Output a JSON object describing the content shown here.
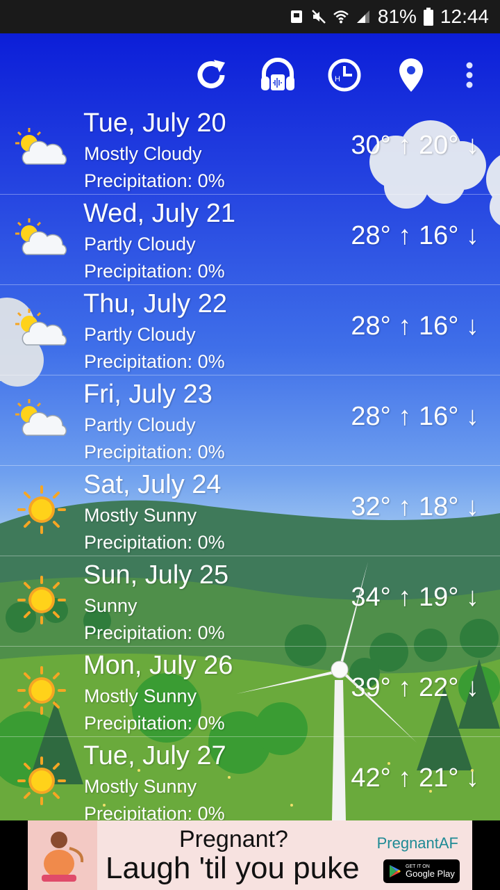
{
  "status_bar": {
    "battery": "81%",
    "time": "12:44"
  },
  "toolbar": {
    "refresh_icon": "refresh-icon",
    "sounds_icon": "headphones-icon",
    "hourly_icon": "hourly-clock-icon",
    "location_icon": "location-pin-icon",
    "menu_icon": "more-vert-icon"
  },
  "forecast": [
    {
      "date": "Tue, July 20",
      "condition": "Mostly Cloudy",
      "precipitation": "Precipitation:  0%",
      "temps": "30° ↑ 20° ↓",
      "icon": "sun-cloud"
    },
    {
      "date": "Wed, July 21",
      "condition": "Partly Cloudy",
      "precipitation": "Precipitation:  0%",
      "temps": "28° ↑ 16° ↓",
      "icon": "sun-cloud"
    },
    {
      "date": "Thu, July 22",
      "condition": "Partly Cloudy",
      "precipitation": "Precipitation:  0%",
      "temps": "28° ↑ 16° ↓",
      "icon": "sun-cloud"
    },
    {
      "date": "Fri, July 23",
      "condition": "Partly Cloudy",
      "precipitation": "Precipitation:  0%",
      "temps": "28° ↑ 16° ↓",
      "icon": "sun-cloud"
    },
    {
      "date": "Sat, July 24",
      "condition": "Mostly Sunny",
      "precipitation": "Precipitation:  0%",
      "temps": "32° ↑ 18° ↓",
      "icon": "sun"
    },
    {
      "date": "Sun, July 25",
      "condition": "Sunny",
      "precipitation": "Precipitation:  0%",
      "temps": "34° ↑ 19° ↓",
      "icon": "sun"
    },
    {
      "date": "Mon, July 26",
      "condition": "Mostly Sunny",
      "precipitation": "Precipitation:  0%",
      "temps": "39° ↑ 22° ↓",
      "icon": "sun"
    },
    {
      "date": "Tue, July 27",
      "condition": "Mostly Sunny",
      "precipitation": "Precipitation:  0%",
      "temps": "42° ↑ 21° ↓",
      "icon": "sun"
    }
  ],
  "ad": {
    "headline": "Pregnant?",
    "body": "Laugh 'til you puke",
    "brand": "PregnantAF",
    "store_small": "GET IT ON",
    "store_big": "Google Play"
  },
  "colors": {
    "sky_top": "#0c1ed8",
    "sun": "#ffd21a",
    "sun_rays": "#f6a623",
    "cloud": "#f5f7fa"
  }
}
